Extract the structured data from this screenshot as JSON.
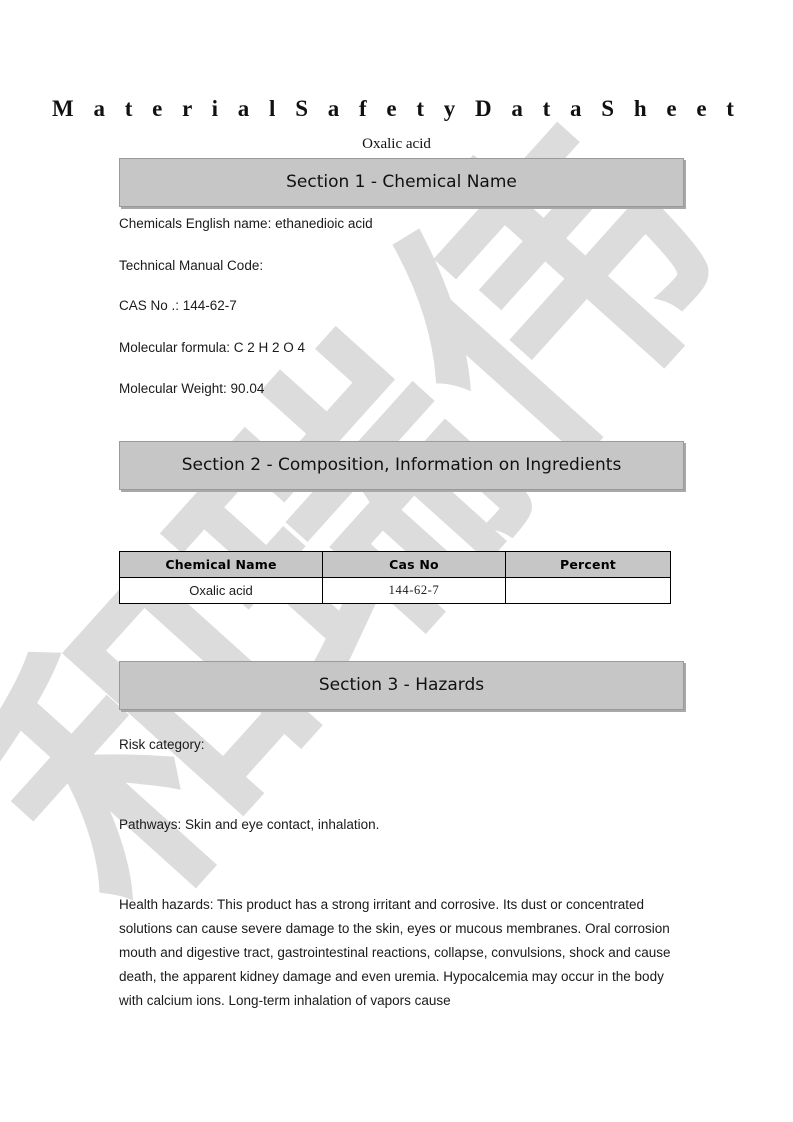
{
  "document": {
    "title": "M a t e r i a l   S a f e t y   D a t a   S h e e t",
    "subtitle": "Oxalic acid"
  },
  "watermark": {
    "text": "和瑞伟",
    "color": "#dcdcdc",
    "rotation_deg": -48
  },
  "sections": [
    {
      "id": "section-1",
      "heading": "Section 1 - Chemical Name",
      "fields": [
        {
          "label": "Chemicals English name:",
          "value": "ethanedioic acid",
          "text": "Chemicals English name: ethanedioic acid"
        },
        {
          "label": "Technical Manual Code:",
          "value": "",
          "text": "Technical Manual Code:"
        },
        {
          "label": "CAS No .:",
          "value": "144-62-7",
          "text": "CAS No .: 144-62-7"
        },
        {
          "label": "Molecular formula:",
          "value": "C 2 H 2 O 4",
          "text": "Molecular formula: C 2 H 2 O 4"
        },
        {
          "label": "Molecular Weight:",
          "value": "90.04",
          "text": "Molecular Weight: 90.04"
        }
      ]
    },
    {
      "id": "section-2",
      "heading": "Section 2 - Composition, Information on Ingredients",
      "table": {
        "headers": [
          "Chemical Name",
          "Cas   No",
          "Percent"
        ],
        "rows": [
          [
            "Oxalic acid",
            "144-62-7",
            ""
          ]
        ]
      }
    },
    {
      "id": "section-3",
      "heading": "Section 3 - Hazards",
      "fields": [
        {
          "label": "Risk category:",
          "value": "",
          "text": "Risk category:"
        },
        {
          "label": "Pathways:",
          "value": "Skin and eye contact, inhalation.",
          "text": "Pathways: Skin and eye contact, inhalation."
        }
      ],
      "paragraph": "Health hazards: This product has a strong irritant and corrosive. Its dust or concentrated solutions can cause severe damage to the skin, eyes or mucous membranes. Oral corrosion mouth and digestive tract, gastrointestinal reactions, collapse, convulsions, shock and cause death, the apparent kidney damage and even uremia. Hypocalcemia may occur in the body with calcium ions. Long-term inhalation of vapors cause"
    }
  ],
  "colors": {
    "section_bar_fill": "#c6c6c6",
    "section_bar_border": "#9a9a9a",
    "table_header_fill": "#c6c6c6",
    "table_border": "#000000",
    "page_background": "#ffffff",
    "text": "#1a1a1a"
  }
}
